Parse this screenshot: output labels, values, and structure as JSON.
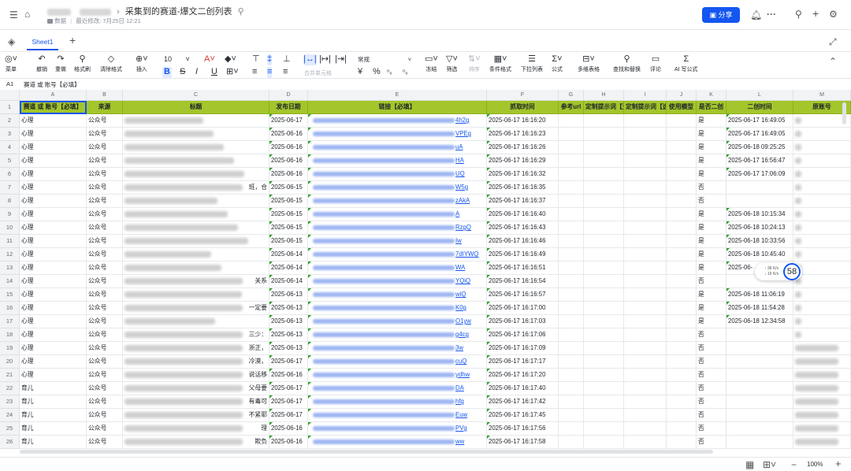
{
  "doc": {
    "title_tail": "采集到的赛道-爆文二创列表",
    "folder": "数据",
    "modified": "最近修改: 7月25日 12:21",
    "share_label": "分享"
  },
  "tabs": {
    "sheet1": "Sheet1"
  },
  "toolbar": {
    "menu": "菜单",
    "undo": "撤销",
    "redo": "重做",
    "format_painter": "格式刷",
    "clear_format": "清除格式",
    "insert": "插入",
    "font_size": "10",
    "merge": "合并单元格",
    "number_format": "常规",
    "freeze": "冻结",
    "filter": "筛选",
    "sort": "排序",
    "conditional": "条件格式",
    "dropdown": "下拉列表",
    "formula": "公式",
    "multi_table": "多维表格",
    "find_replace": "查找和替换",
    "comment": "评论",
    "ai_formula": "AI 写公式"
  },
  "formula_bar": {
    "ref": "A1",
    "content": "赛道 或 账号【必填】"
  },
  "columns": [
    "A",
    "B",
    "C",
    "D",
    "E",
    "F",
    "G",
    "H",
    "I",
    "J",
    "K",
    "L",
    "M"
  ],
  "header_row": [
    "赛道 或 账号【必填】",
    "来源",
    "标题",
    "发布日期",
    "链接【必填】",
    "抓取时间",
    "参考url",
    "定制提示词【选填】",
    "定制提示词【选填】",
    "使用模型",
    "是否二创",
    "二创时间",
    "原账号"
  ],
  "rows": [
    {
      "n": "2",
      "a": "心理",
      "b": "公众号",
      "c_tail": "",
      "d": "2025-06-17",
      "e_tail": "4h2g",
      "f": "2025-06-17 16:16:20",
      "k": "是",
      "l": "2025-06-17 16:49:05"
    },
    {
      "n": "3",
      "a": "心理",
      "b": "公众号",
      "c_tail": "",
      "d": "2025-06-16",
      "e_tail": "VPEg",
      "f": "2025-06-17 16:16:23",
      "k": "是",
      "l": "2025-06-17 16:49:05"
    },
    {
      "n": "4",
      "a": "心理",
      "b": "公众号",
      "c_tail": "",
      "d": "2025-06-16",
      "e_tail": "uA",
      "f": "2025-06-17 16:16:26",
      "k": "是",
      "l": "2025-06-18 09:25:25"
    },
    {
      "n": "5",
      "a": "心理",
      "b": "公众号",
      "c_tail": "",
      "d": "2025-06-16",
      "e_tail": "HA",
      "f": "2025-06-17 16:16:29",
      "k": "是",
      "l": "2025-06-17 16:56:47"
    },
    {
      "n": "6",
      "a": "心理",
      "b": "公众号",
      "c_tail": "",
      "d": "2025-06-16",
      "e_tail": "UQ",
      "f": "2025-06-17 16:16:32",
      "k": "是",
      "l": "2025-06-17 17:06:09"
    },
    {
      "n": "7",
      "a": "心理",
      "b": "公众号",
      "c_tail": "班，仓",
      "d": "2025-06-15",
      "e_tail": "W5g",
      "f": "2025-06-17 16:16:35",
      "k": "否",
      "l": ""
    },
    {
      "n": "8",
      "a": "心理",
      "b": "公众号",
      "c_tail": "",
      "d": "2025-06-15",
      "e_tail": "zAkA",
      "f": "2025-06-17 16:16:37",
      "k": "否",
      "l": ""
    },
    {
      "n": "9",
      "a": "心理",
      "b": "公众号",
      "c_tail": "",
      "d": "2025-06-15",
      "e_tail": "A",
      "f": "2025-06-17 16:16:40",
      "k": "是",
      "l": "2025-06-18 10:15:34"
    },
    {
      "n": "10",
      "a": "心理",
      "b": "公众号",
      "c_tail": "",
      "d": "2025-06-15",
      "e_tail": "RzgQ",
      "f": "2025-06-17 16:16:43",
      "k": "是",
      "l": "2025-06-18 10:24:13"
    },
    {
      "n": "11",
      "a": "心理",
      "b": "公众号",
      "c_tail": "",
      "d": "2025-06-15",
      "e_tail": "Iw",
      "f": "2025-06-17 16:16:46",
      "k": "是",
      "l": "2025-06-18 10:33:56"
    },
    {
      "n": "12",
      "a": "心理",
      "b": "公众号",
      "c_tail": "",
      "d": "2025-06-14",
      "e_tail": "7dIYWQ",
      "f": "2025-06-17 16:16:49",
      "k": "是",
      "l": "2025-06-18 10:45:40"
    },
    {
      "n": "13",
      "a": "心理",
      "b": "公众号",
      "c_tail": "",
      "d": "2025-06-14",
      "e_tail": "WA",
      "f": "2025-06-17 16:16:51",
      "k": "是",
      "l": "2025-06-"
    },
    {
      "n": "14",
      "a": "心理",
      "b": "公众号",
      "c_tail": "关系",
      "d": "2025-06-14",
      "e_tail": "YQiQ",
      "f": "2025-06-17 16:16:54",
      "k": "否",
      "l": ""
    },
    {
      "n": "15",
      "a": "心理",
      "b": "公众号",
      "c_tail": "",
      "d": "2025-06-13",
      "e_tail": "wiQ",
      "f": "2025-06-17 16:16:57",
      "k": "是",
      "l": "2025-06-18 11:06:19"
    },
    {
      "n": "16",
      "a": "心理",
      "b": "公众号",
      "c_tail": "一定要",
      "d": "2025-06-13",
      "e_tail": "K0g",
      "f": "2025-06-17 16:17:00",
      "k": "是",
      "l": "2025-06-18 11:54:28"
    },
    {
      "n": "17",
      "a": "心理",
      "b": "公众号",
      "c_tail": "",
      "d": "2025-06-13",
      "e_tail": "O1yw",
      "f": "2025-06-17 16:17:03",
      "k": "是",
      "l": "2025-06-18 12:34:58"
    },
    {
      "n": "18",
      "a": "心理",
      "b": "公众号",
      "c_tail": "三少：",
      "d": "2025-06-13",
      "e_tail": "g4cg",
      "f": "2025-06-17 16:17:06",
      "k": "否",
      "l": ""
    },
    {
      "n": "19",
      "a": "心理",
      "b": "公众号",
      "c_tail": "浙正，",
      "d": "2025-06-13",
      "e_tail": "3w",
      "f": "2025-06-17 16:17:09",
      "k": "否",
      "l": ""
    },
    {
      "n": "20",
      "a": "心理",
      "b": "公众号",
      "c_tail": "冷漠，",
      "d": "2025-06-17",
      "e_tail": "cuQ",
      "f": "2025-06-17 16:17:17",
      "k": "否",
      "l": ""
    },
    {
      "n": "21",
      "a": "心理",
      "b": "公众号",
      "c_tail": "说话移",
      "d": "2025-06-16",
      "e_tail": "ydhw",
      "f": "2025-06-17 16:17:20",
      "k": "否",
      "l": ""
    },
    {
      "n": "22",
      "a": "育儿",
      "b": "公众号",
      "c_tail": "父母要",
      "d": "2025-06-17",
      "e_tail": "DA",
      "f": "2025-06-17 16:17:40",
      "k": "否",
      "l": ""
    },
    {
      "n": "23",
      "a": "育儿",
      "b": "公众号",
      "c_tail": "有毒可",
      "d": "2025-06-17",
      "e_tail": "hfg",
      "f": "2025-06-17 16:17:42",
      "k": "否",
      "l": ""
    },
    {
      "n": "24",
      "a": "育儿",
      "b": "公众号",
      "c_tail": "不紧耶",
      "d": "2025-06-17",
      "e_tail": "Euw",
      "f": "2025-06-17 16:17:45",
      "k": "否",
      "l": ""
    },
    {
      "n": "25",
      "a": "育儿",
      "b": "公众号",
      "c_tail": "理",
      "d": "2025-06-16",
      "e_tail": "PVg",
      "f": "2025-06-17 16:17:56",
      "k": "否",
      "l": ""
    },
    {
      "n": "26",
      "a": "育儿",
      "b": "公众号",
      "c_tail": "欺负",
      "d": "2025-06-16",
      "e_tail": "ww",
      "f": "2025-06-17 16:17:58",
      "k": "否",
      "l": ""
    }
  ],
  "speed_widget": {
    "up": "↑ 38 K/s",
    "down": "↓ 19 K/s",
    "value": "58"
  },
  "footer": {
    "zoom": "100%"
  }
}
